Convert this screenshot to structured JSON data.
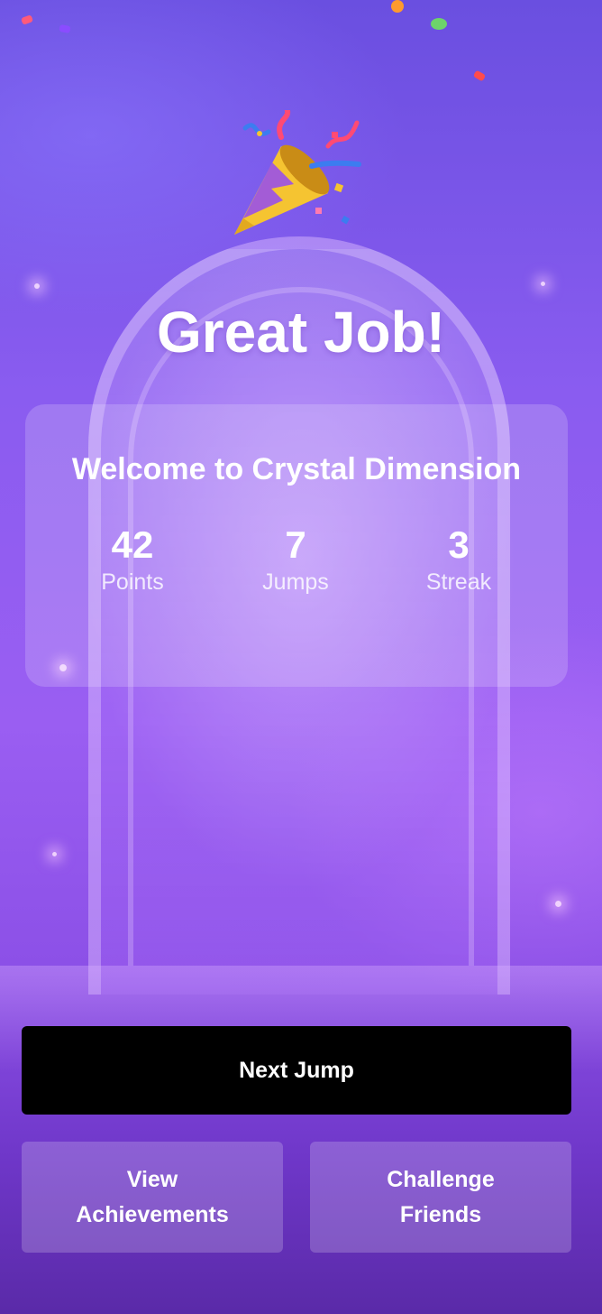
{
  "header": {
    "icon": "party-popper-icon",
    "title": "Great Job!"
  },
  "summary": {
    "heading": "Welcome to Crystal Dimension",
    "stats": [
      {
        "value": "42",
        "label": "Points"
      },
      {
        "value": "7",
        "label": "Jumps"
      },
      {
        "value": "3",
        "label": "Streak"
      }
    ]
  },
  "actions": {
    "primary_label": "Next Jump",
    "achievements_label": "View Achievements",
    "challenge_label": "Challenge Friends"
  },
  "colors": {
    "background_top": "#6a4fe0",
    "background_bottom": "#5a2aa8",
    "primary_button": "#000000",
    "text": "#ffffff"
  }
}
